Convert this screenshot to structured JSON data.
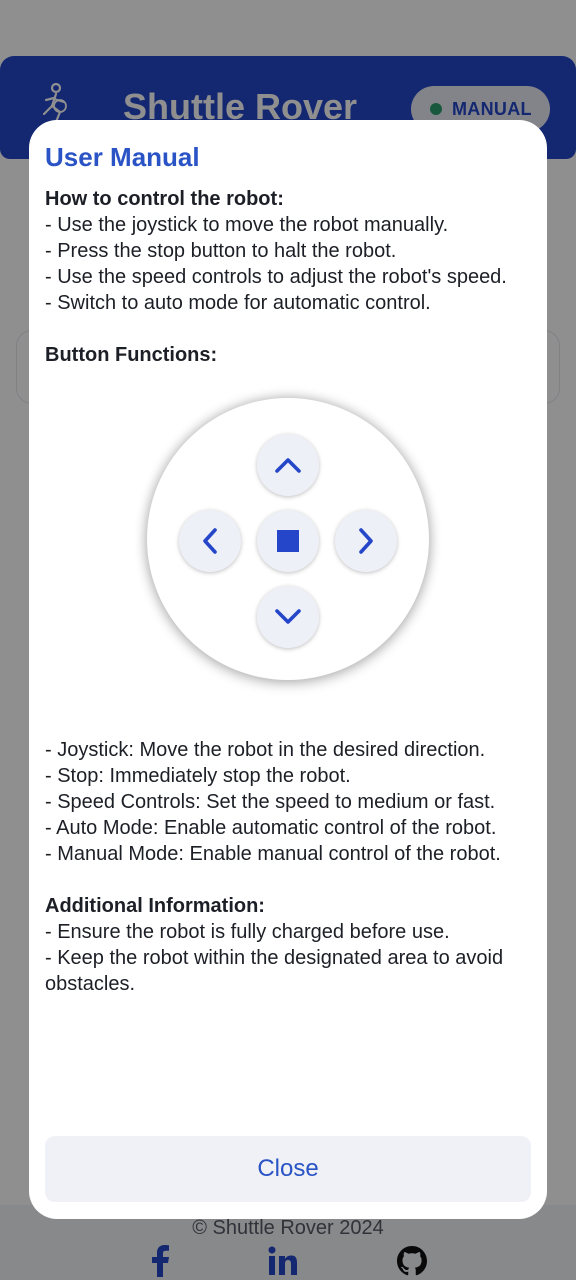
{
  "app": {
    "title": "Shuttle Rover",
    "mode_label": "MANUAL",
    "footer_copyright": "© Shuttle Rover 2024"
  },
  "colors": {
    "brand_blue": "#2546c9",
    "dialog_accent": "#2a53c5",
    "mode_dot": "#2f9e6d"
  },
  "icons": {
    "logo": "robot-logo-icon",
    "social": [
      "facebook-icon",
      "linkedin-icon",
      "github-icon"
    ]
  },
  "dialog": {
    "title": "User Manual",
    "sections": [
      {
        "heading": "How to control the robot:",
        "lines": [
          "- Use the joystick to move the robot manually.",
          "- Press the stop button to halt the robot.",
          "- Use the speed controls to adjust the robot's speed.",
          "- Switch to auto mode for automatic control."
        ]
      },
      {
        "heading": "Button Functions:",
        "lines": [
          "- Joystick: Move the robot in the desired direction.",
          "- Stop: Immediately stop the robot.",
          "- Speed Controls: Set the speed to medium or fast.",
          "- Auto Mode: Enable automatic control of the robot.",
          "- Manual Mode: Enable manual control of the robot."
        ]
      },
      {
        "heading": "Additional Information:",
        "lines": [
          "- Ensure the robot is fully charged before use.",
          "- Keep the robot within the designated area to avoid obstacles."
        ]
      }
    ],
    "diagram_buttons": [
      "chevron-up-icon",
      "chevron-left-icon",
      "stop-square-icon",
      "chevron-right-icon",
      "chevron-down-icon"
    ],
    "close_label": "Close"
  }
}
